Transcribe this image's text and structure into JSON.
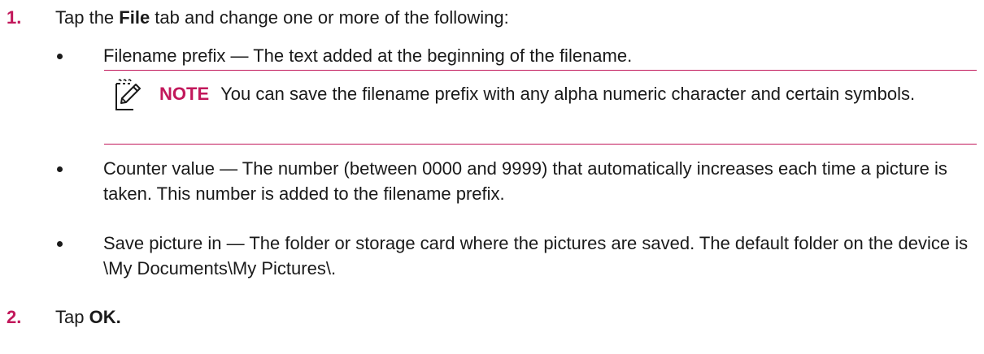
{
  "accent_color": "#c2185b",
  "steps": [
    {
      "number": "1.",
      "before": "Tap the ",
      "bold": "File",
      "after": " tab and change one or more of the following:"
    },
    {
      "number": "2.",
      "before": "Tap ",
      "bold": "OK.",
      "after": ""
    }
  ],
  "bullets": [
    "Filename prefix — The text added at the beginning of the filename.",
    "Counter value — The number (between 0000 and 9999) that automatically increases each time a picture is taken. This number is added to the filename prefix.",
    "Save picture in — The folder or storage card where the pictures are saved. The default folder on the device is \\My Documents\\My Pictures\\."
  ],
  "note": {
    "label": "NOTE",
    "text": "You can save the filename prefix with any alpha numeric character and certain symbols.",
    "icon": "note-pencil-icon"
  }
}
